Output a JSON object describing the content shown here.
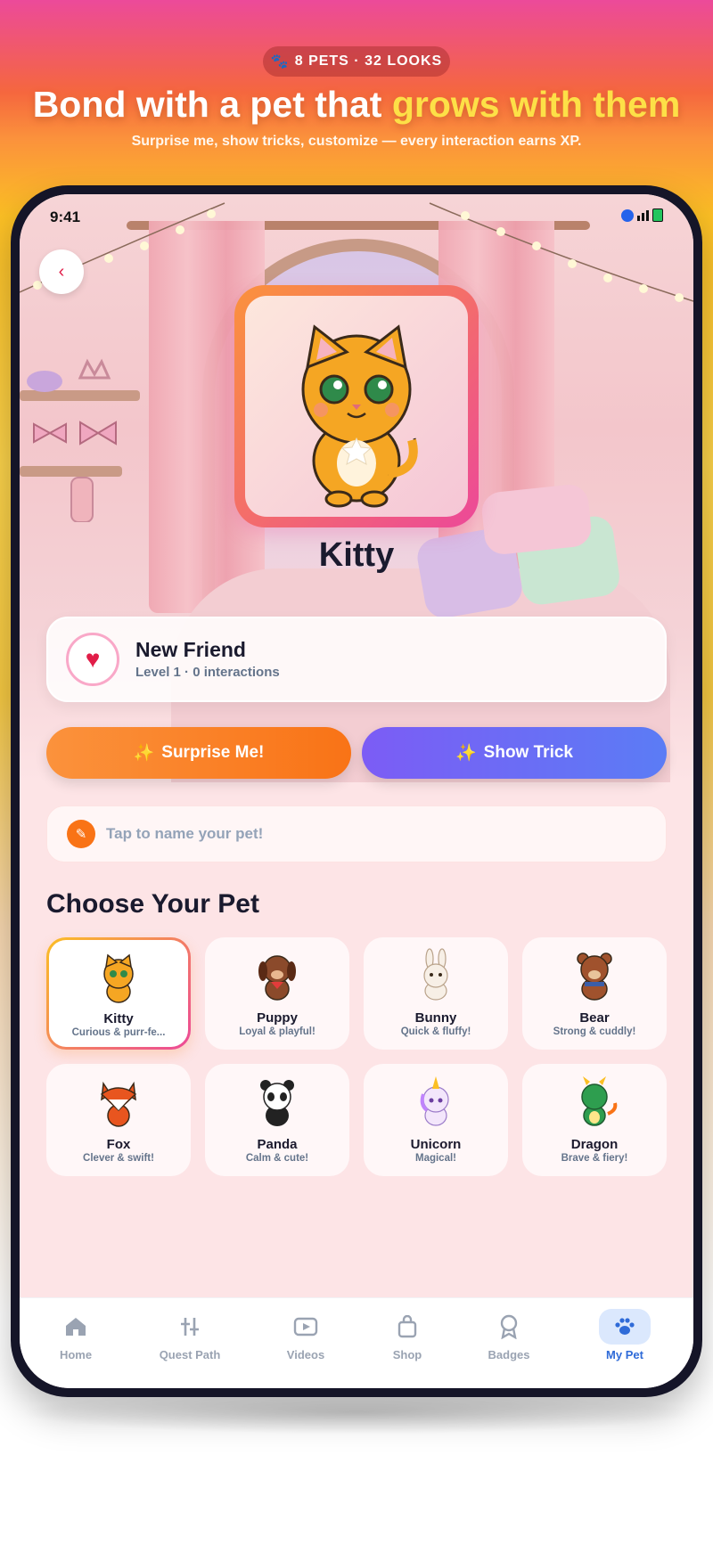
{
  "promo": {
    "badge": "8 PETS · 32 LOOKS",
    "headline_part1": "Bond with a pet that ",
    "headline_highlight": "grows with them",
    "subtitle": "Surprise me, show tricks, customize — every interaction earns XP."
  },
  "status_bar": {
    "time": "9:41"
  },
  "pet": {
    "name": "Kitty",
    "bond_title": "New Friend",
    "bond_sub": "Level 1 · 0 interactions"
  },
  "actions": {
    "surprise_label": "Surprise Me!",
    "trick_label": "Show Trick"
  },
  "name_field": {
    "placeholder": "Tap to name your pet!"
  },
  "chooser": {
    "title": "Choose Your Pet",
    "pets": [
      {
        "name": "Kitty",
        "desc": "Curious & purr-fe...",
        "icon": "cat-icon",
        "selected": true
      },
      {
        "name": "Puppy",
        "desc": "Loyal & playful!",
        "icon": "puppy-icon"
      },
      {
        "name": "Bunny",
        "desc": "Quick & fluffy!",
        "icon": "bunny-icon"
      },
      {
        "name": "Bear",
        "desc": "Strong & cuddly!",
        "icon": "bear-icon"
      },
      {
        "name": "Fox",
        "desc": "Clever & swift!",
        "icon": "fox-icon"
      },
      {
        "name": "Panda",
        "desc": "Calm & cute!",
        "icon": "panda-icon"
      },
      {
        "name": "Unicorn",
        "desc": "Magical!",
        "icon": "unicorn-icon"
      },
      {
        "name": "Dragon",
        "desc": "Brave & fiery!",
        "icon": "dragon-icon"
      }
    ]
  },
  "tabs": [
    {
      "label": "Home",
      "icon": "home-icon"
    },
    {
      "label": "Quest Path",
      "icon": "quest-path-icon"
    },
    {
      "label": "Videos",
      "icon": "video-icon"
    },
    {
      "label": "Shop",
      "icon": "shopping-bag-icon"
    },
    {
      "label": "Badges",
      "icon": "badge-icon"
    },
    {
      "label": "My Pet",
      "icon": "paw-icon",
      "active": true
    }
  ],
  "colors": {
    "accent_orange": "#f97316",
    "accent_purple": "#7c5cf5",
    "tab_active": "#2f6bd8",
    "heart": "#e11d48"
  }
}
